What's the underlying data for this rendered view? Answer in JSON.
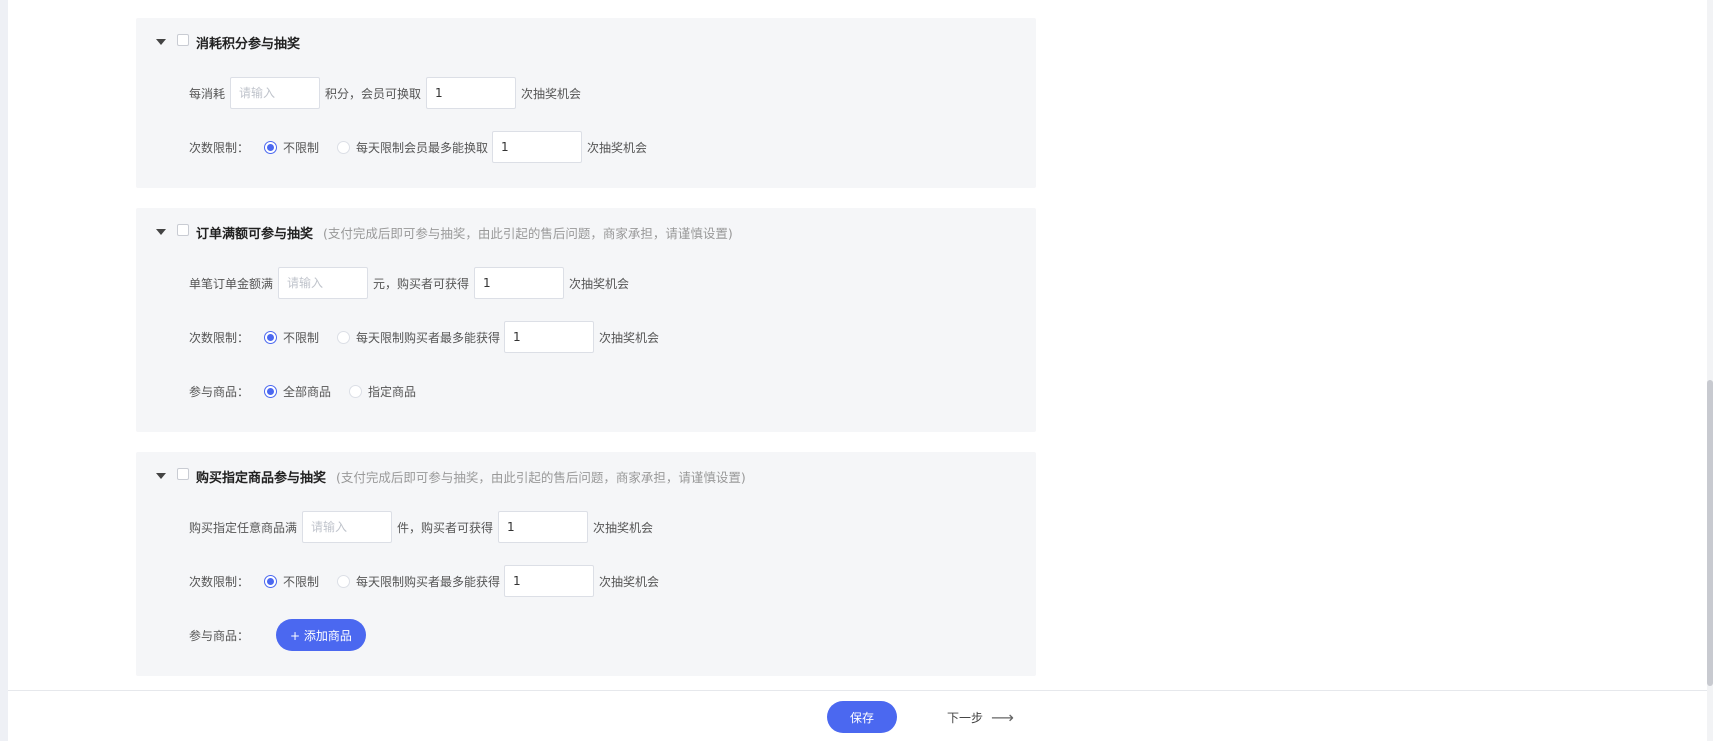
{
  "sections": [
    {
      "title": "消耗积分参与抽奖",
      "note": "",
      "row1": {
        "prefix": "每消耗",
        "input_placeholder": "请输入",
        "middle": "积分，会员可换取",
        "count_value": "1",
        "suffix": "次抽奖机会"
      },
      "row2": {
        "label": "次数限制：",
        "option_unlimited": "不限制",
        "option_limited": "每天限制会员最多能换取",
        "limit_value": "1",
        "suffix": "次抽奖机会"
      }
    },
    {
      "title": "订单满额可参与抽奖",
      "note": "(支付完成后即可参与抽奖，由此引起的售后问题，商家承担，请谨慎设置)",
      "row1": {
        "prefix": "单笔订单金额满",
        "input_placeholder": "请输入",
        "middle": "元，购买者可获得",
        "count_value": "1",
        "suffix": "次抽奖机会"
      },
      "row2": {
        "label": "次数限制：",
        "option_unlimited": "不限制",
        "option_limited": "每天限制购买者最多能获得",
        "limit_value": "1",
        "suffix": "次抽奖机会"
      },
      "row3": {
        "label": "参与商品：",
        "option_all": "全部商品",
        "option_specified": "指定商品"
      }
    },
    {
      "title": "购买指定商品参与抽奖",
      "note": "(支付完成后即可参与抽奖，由此引起的售后问题，商家承担，请谨慎设置)",
      "row1": {
        "prefix": "购买指定任意商品满",
        "input_placeholder": "请输入",
        "middle": "件，购买者可获得",
        "count_value": "1",
        "suffix": "次抽奖机会"
      },
      "row2": {
        "label": "次数限制：",
        "option_unlimited": "不限制",
        "option_limited": "每天限制购买者最多能获得",
        "limit_value": "1",
        "suffix": "次抽奖机会"
      },
      "row3": {
        "label": "参与商品：",
        "add_button": "+ 添加商品"
      }
    }
  ],
  "footer": {
    "save_label": "保存",
    "next_label": "下一步",
    "next_arrow": "⟶"
  },
  "colors": {
    "primary": "#4b68f0",
    "section_bg": "#f5f6f8",
    "note": "#999999"
  }
}
